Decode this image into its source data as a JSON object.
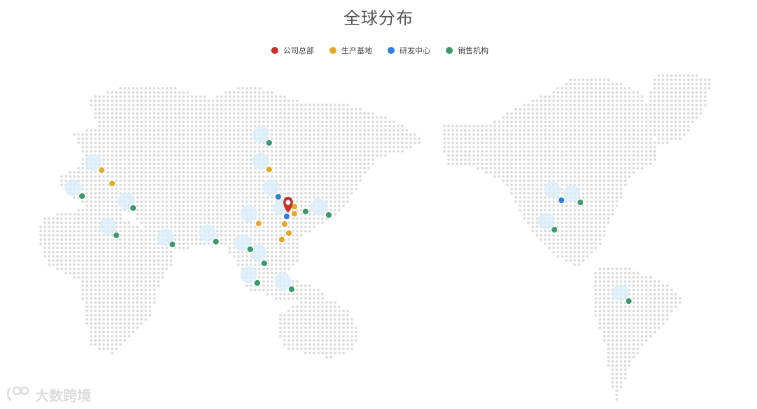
{
  "title": "全球分布",
  "legend": [
    {
      "label": "公司总部",
      "color": "#c8312a"
    },
    {
      "label": "生产基地",
      "color": "#e2aa28"
    },
    {
      "label": "研发中心",
      "color": "#2f7ed8"
    },
    {
      "label": "销售机构",
      "color": "#3a9a6e"
    }
  ],
  "watermark": "大数跨境",
  "colors": {
    "dot_grid": "#dcdcdc",
    "glow": "#d9eefb"
  }
}
